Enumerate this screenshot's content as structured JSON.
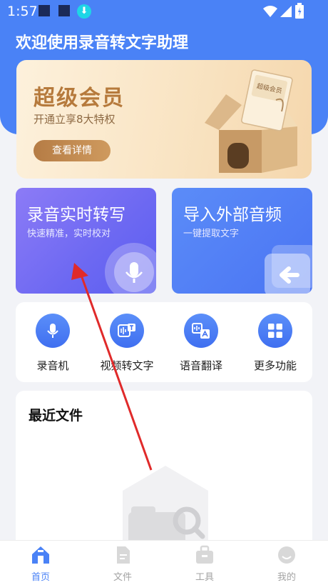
{
  "status_bar": {
    "time": "1:57"
  },
  "app": {
    "title": "欢迎使用录音转文字助理"
  },
  "vip_banner": {
    "title": "超级会员",
    "subtitle": "开通立享8大特权",
    "button_label": "查看详情",
    "card_text": "超级会员"
  },
  "feature_cards": [
    {
      "title": "录音实时转写",
      "subtitle": "快速精准，实时校对",
      "icon": "mic-icon"
    },
    {
      "title": "导入外部音频",
      "subtitle": "一键提取文字",
      "icon": "import-arrow-icon"
    }
  ],
  "tools": [
    {
      "label": "录音机",
      "icon": "mic-icon"
    },
    {
      "label": "视频转文字",
      "icon": "video-to-text-icon"
    },
    {
      "label": "语音翻译",
      "icon": "voice-translate-icon"
    },
    {
      "label": "更多功能",
      "icon": "grid-icon"
    }
  ],
  "recent": {
    "title": "最近文件"
  },
  "tabbar": {
    "items": [
      {
        "label": "首页",
        "icon": "home-icon",
        "active": true
      },
      {
        "label": "文件",
        "icon": "file-icon",
        "active": false
      },
      {
        "label": "工具",
        "icon": "toolbox-icon",
        "active": false
      },
      {
        "label": "我的",
        "icon": "profile-icon",
        "active": false
      }
    ]
  },
  "colors": {
    "primary": "#4a82f6",
    "annotation_arrow": "#e02a2a",
    "vip_gold": "#b67a3c"
  }
}
